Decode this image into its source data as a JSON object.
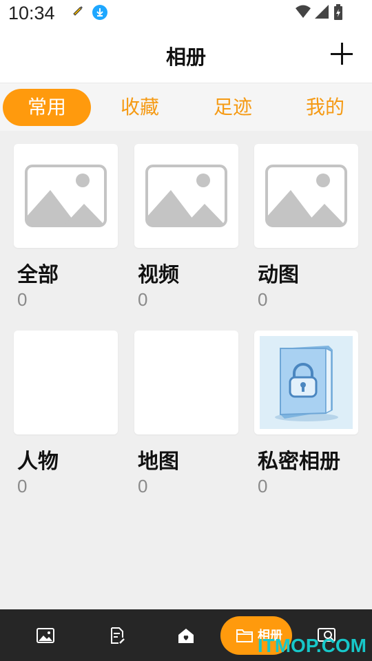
{
  "status_bar": {
    "time": "10:34"
  },
  "header": {
    "title": "相册"
  },
  "tabs": [
    {
      "label": "常用",
      "active": true
    },
    {
      "label": "收藏",
      "active": false
    },
    {
      "label": "足迹",
      "active": false
    },
    {
      "label": "我的",
      "active": false
    }
  ],
  "albums": [
    {
      "title": "全部",
      "count": "0",
      "thumbnail": "image-placeholder-icon"
    },
    {
      "title": "视频",
      "count": "0",
      "thumbnail": "image-placeholder-icon"
    },
    {
      "title": "动图",
      "count": "0",
      "thumbnail": "image-placeholder-icon"
    },
    {
      "title": "人物",
      "count": "0",
      "thumbnail": "blank"
    },
    {
      "title": "地图",
      "count": "0",
      "thumbnail": "blank"
    },
    {
      "title": "私密相册",
      "count": "0",
      "thumbnail": "locked-book-icon"
    }
  ],
  "bottom_nav": {
    "items": [
      {
        "icon": "photo-icon"
      },
      {
        "icon": "document-edit-icon"
      },
      {
        "icon": "home-icon"
      },
      {
        "icon": "folder-icon",
        "label": "相册",
        "active": true
      },
      {
        "icon": "screen-search-icon"
      }
    ]
  },
  "watermark": "ITMOP.COM",
  "colors": {
    "accent": "#ff9a0d",
    "tab_text": "#f59a14",
    "nav_bg": "#262626",
    "watermark": "#17c7c9"
  }
}
